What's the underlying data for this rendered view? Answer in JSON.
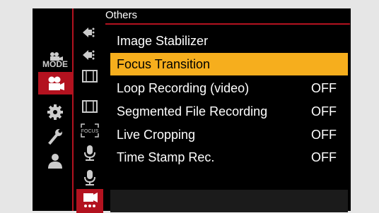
{
  "header": {
    "title": "Others"
  },
  "left_tabs": [
    {
      "name": "mode",
      "label": "MODE"
    },
    {
      "name": "video",
      "active": true
    },
    {
      "name": "settings"
    },
    {
      "name": "custom"
    },
    {
      "name": "user"
    }
  ],
  "sub_tabs": [
    {
      "icon": "video-af-icon"
    },
    {
      "icon": "video-af-icon"
    },
    {
      "icon": "film-frame-icon"
    },
    {
      "icon": "film-frame-icon"
    },
    {
      "icon": "focus-frame-icon",
      "label": "FOCUS"
    },
    {
      "icon": "microphone-icon"
    },
    {
      "icon": "microphone-icon"
    },
    {
      "icon": "video-others-icon",
      "active": true
    }
  ],
  "menu": {
    "items": [
      {
        "label": "Image Stabilizer",
        "value": ""
      },
      {
        "label": "Focus Transition",
        "value": "",
        "selected": true
      },
      {
        "label": "Loop Recording (video)",
        "value": "OFF"
      },
      {
        "label": "Segmented File Recording",
        "value": "OFF"
      },
      {
        "label": "Live Cropping",
        "value": "OFF"
      },
      {
        "label": "Time Stamp Rec.",
        "value": "OFF"
      }
    ]
  },
  "colors": {
    "accent": "#b3121f",
    "highlight": "#f6ae1d",
    "background": "#000000"
  }
}
